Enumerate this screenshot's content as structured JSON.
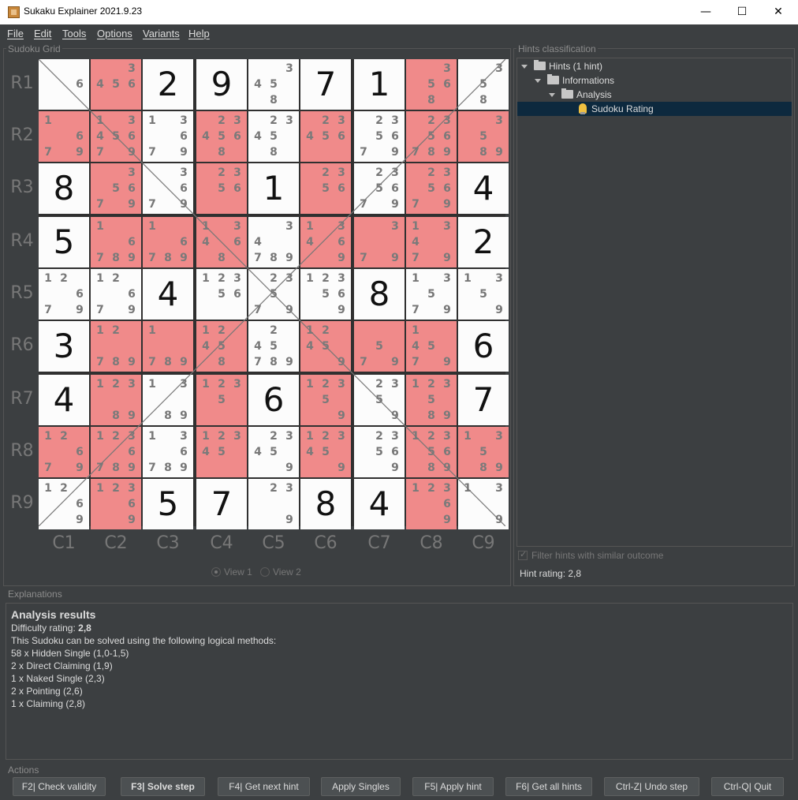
{
  "window": {
    "title": "Sukaku Explainer 2021.9.23",
    "minimize": "—",
    "maximize": "☐",
    "close": "✕"
  },
  "menu": [
    "File",
    "Edit",
    "Tools",
    "Options",
    "Variants",
    "Help"
  ],
  "panels": {
    "grid_title": "Sudoku Grid",
    "hints_title": "Hints classification",
    "explanations_title": "Explanations",
    "actions_title": "Actions"
  },
  "grid": {
    "row_labels": [
      "R1",
      "R2",
      "R3",
      "R4",
      "R5",
      "R6",
      "R7",
      "R8",
      "R9"
    ],
    "col_labels": [
      "C1",
      "C2",
      "C3",
      "C4",
      "C5",
      "C6",
      "C7",
      "C8",
      "C9"
    ],
    "cells": [
      [
        {
          "c": [
            6
          ]
        },
        {
          "c": [
            3,
            4,
            5,
            6,
            6
          ],
          "r": 1,
          "cands": [
            3,
            4,
            5,
            6,
            6
          ]
        },
        {
          "v": 2
        },
        {
          "v": 9
        },
        {
          "c": [
            3,
            4,
            5,
            8
          ]
        },
        {
          "v": 7
        },
        {
          "v": 1
        },
        {
          "c": [
            3,
            5,
            6,
            8
          ],
          "r": 1
        },
        {
          "c": [
            3,
            5,
            8
          ]
        }
      ],
      [
        {
          "c": [
            1,
            6,
            7,
            9
          ],
          "r": 1
        },
        {
          "c": [
            1,
            3,
            4,
            5,
            6,
            7,
            9
          ],
          "r": 1
        },
        {
          "c": [
            1,
            3,
            6,
            7,
            9
          ]
        },
        {
          "c": [
            2,
            3,
            4,
            5,
            6,
            8
          ],
          "r": 1
        },
        {
          "c": [
            2,
            3,
            4,
            5,
            8
          ]
        },
        {
          "c": [
            2,
            3,
            4,
            5,
            6
          ],
          "r": 1
        },
        {
          "c": [
            2,
            3,
            5,
            6,
            7,
            9
          ]
        },
        {
          "c": [
            2,
            3,
            5,
            6,
            7,
            8,
            9
          ],
          "r": 1
        },
        {
          "c": [
            3,
            5,
            8,
            9
          ],
          "r": 1
        }
      ],
      [
        {
          "v": 8
        },
        {
          "c": [
            3,
            5,
            6,
            7,
            9
          ],
          "r": 1
        },
        {
          "c": [
            3,
            6,
            7,
            9
          ]
        },
        {
          "c": [
            2,
            3,
            5,
            6
          ],
          "r": 1
        },
        {
          "v": 1
        },
        {
          "c": [
            2,
            3,
            5,
            6
          ],
          "r": 1
        },
        {
          "c": [
            2,
            3,
            5,
            6,
            7,
            9
          ]
        },
        {
          "c": [
            2,
            3,
            5,
            6,
            7,
            9
          ],
          "r": 1
        },
        {
          "v": 4
        }
      ],
      [
        {
          "v": 5
        },
        {
          "c": [
            1,
            6,
            7,
            8,
            9
          ],
          "r": 1
        },
        {
          "c": [
            1,
            6,
            7,
            8,
            9
          ],
          "r": 1
        },
        {
          "c": [
            1,
            3,
            4,
            6,
            8
          ],
          "r": 1
        },
        {
          "c": [
            3,
            4,
            7,
            8,
            9
          ]
        },
        {
          "c": [
            1,
            3,
            4,
            6,
            9
          ],
          "r": 1
        },
        {
          "c": [
            3,
            7,
            9
          ],
          "r": 1
        },
        {
          "c": [
            1,
            3,
            4,
            7,
            9
          ],
          "r": 1
        },
        {
          "v": 2
        }
      ],
      [
        {
          "c": [
            1,
            2,
            6,
            7,
            9
          ]
        },
        {
          "c": [
            1,
            2,
            6,
            7,
            9
          ]
        },
        {
          "v": 4
        },
        {
          "c": [
            1,
            2,
            3,
            5,
            6
          ]
        },
        {
          "c": [
            2,
            3,
            5,
            7,
            9
          ]
        },
        {
          "c": [
            1,
            2,
            3,
            5,
            6,
            9
          ]
        },
        {
          "v": 8
        },
        {
          "c": [
            1,
            3,
            5,
            7,
            9
          ]
        },
        {
          "c": [
            1,
            3,
            5,
            9
          ]
        }
      ],
      [
        {
          "v": 3
        },
        {
          "c": [
            1,
            2,
            7,
            8,
            9
          ],
          "r": 1
        },
        {
          "c": [
            1,
            7,
            8,
            9
          ],
          "r": 1
        },
        {
          "c": [
            1,
            2,
            4,
            5,
            8
          ],
          "r": 1
        },
        {
          "c": [
            2,
            4,
            5,
            7,
            8,
            9
          ]
        },
        {
          "c": [
            1,
            2,
            4,
            5,
            9
          ],
          "r": 1
        },
        {
          "c": [
            5,
            7,
            9
          ],
          "r": 1
        },
        {
          "c": [
            1,
            4,
            5,
            7,
            9
          ],
          "r": 1
        },
        {
          "v": 6
        }
      ],
      [
        {
          "v": 4
        },
        {
          "c": [
            1,
            2,
            3,
            8,
            9
          ],
          "r": 1
        },
        {
          "c": [
            1,
            3,
            8,
            9
          ]
        },
        {
          "c": [
            1,
            2,
            3,
            5
          ],
          "r": 1
        },
        {
          "v": 6
        },
        {
          "c": [
            1,
            2,
            3,
            5,
            9
          ],
          "r": 1
        },
        {
          "c": [
            2,
            3,
            5,
            9
          ]
        },
        {
          "c": [
            1,
            2,
            3,
            5,
            8,
            9
          ],
          "r": 1
        },
        {
          "v": 7
        }
      ],
      [
        {
          "c": [
            1,
            2,
            6,
            7,
            9
          ],
          "r": 1
        },
        {
          "c": [
            1,
            2,
            3,
            6,
            7,
            8,
            9
          ],
          "r": 1
        },
        {
          "c": [
            1,
            3,
            6,
            7,
            8,
            9
          ]
        },
        {
          "c": [
            1,
            2,
            3,
            4,
            5
          ],
          "r": 1
        },
        {
          "c": [
            2,
            3,
            4,
            5,
            9
          ]
        },
        {
          "c": [
            1,
            2,
            3,
            4,
            5,
            9
          ],
          "r": 1
        },
        {
          "c": [
            2,
            3,
            5,
            6,
            9
          ]
        },
        {
          "c": [
            1,
            2,
            3,
            5,
            6,
            8,
            9
          ],
          "r": 1
        },
        {
          "c": [
            1,
            3,
            5,
            8,
            9
          ],
          "r": 1
        }
      ],
      [
        {
          "c": [
            1,
            2,
            6,
            9
          ]
        },
        {
          "c": [
            1,
            2,
            3,
            6,
            9
          ],
          "r": 1
        },
        {
          "v": 5
        },
        {
          "v": 7
        },
        {
          "c": [
            2,
            3,
            9
          ]
        },
        {
          "v": 8
        },
        {
          "v": 4
        },
        {
          "c": [
            1,
            2,
            3,
            6,
            9
          ],
          "r": 1
        },
        {
          "c": [
            1,
            3,
            9
          ]
        }
      ]
    ]
  },
  "views": {
    "view1": "View 1",
    "view2": "View 2"
  },
  "tree": {
    "root": "Hints (1 hint)",
    "informations": "Informations",
    "analysis": "Analysis",
    "rating": "Sudoku Rating"
  },
  "filter_label": "Filter hints with similar outcome",
  "hint_rating": {
    "label": "Hint rating:",
    "value": "2,8"
  },
  "explanations": {
    "title": "Analysis results",
    "difficulty_label": "Difficulty rating: ",
    "difficulty_value": "2,8",
    "intro": "This Sudoku can be solved using the following logical methods:",
    "methods": [
      "58 x Hidden Single (1,0-1,5)",
      "2 x Direct Claiming (1,9)",
      "1 x Naked Single (2,3)",
      "2 x Pointing (2,6)",
      "1 x Claiming (2,8)"
    ]
  },
  "actions": [
    "F2| Check validity",
    "F3| Solve step",
    "F4| Get next hint",
    "Apply Singles",
    "F5| Apply hint",
    "F6| Get all hints",
    "Ctrl-Z| Undo step",
    "Ctrl-Q| Quit"
  ],
  "colors": {
    "highlight": "#f08a8a",
    "cell": "#fcfcfc",
    "background": "#3c3f41",
    "selection": "#0d293e"
  }
}
